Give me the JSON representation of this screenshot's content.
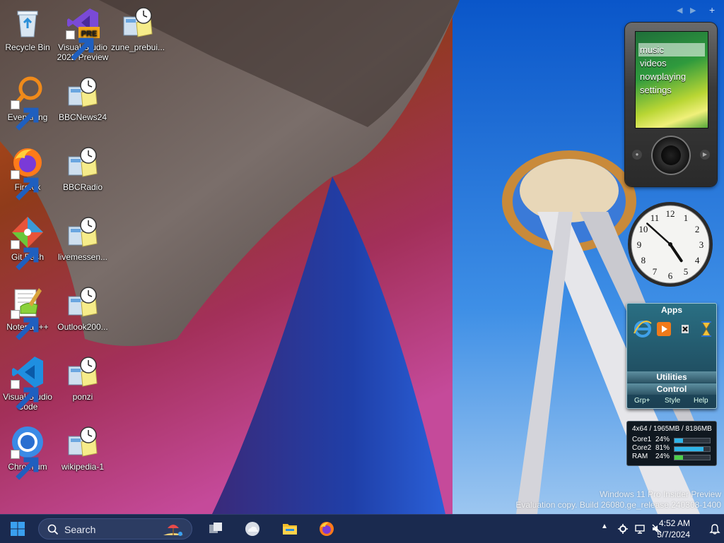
{
  "desktop": {
    "icons": [
      {
        "label": "Recycle Bin",
        "icon": "recycle-bin-icon"
      },
      {
        "label": "Visual Studio 2022 Preview",
        "icon": "visual-studio-preview-icon",
        "badge": "PRE"
      },
      {
        "label": "zune_prebui...",
        "icon": "gadget-file-icon"
      },
      {
        "label": "Everything",
        "icon": "everything-search-icon"
      },
      {
        "label": "BBCNews24",
        "icon": "gadget-file-icon"
      },
      {
        "label": "Firefox",
        "icon": "firefox-icon"
      },
      {
        "label": "BBCRadio",
        "icon": "gadget-file-icon"
      },
      {
        "label": "Git Bash",
        "icon": "git-bash-icon"
      },
      {
        "label": "livemessen...",
        "icon": "gadget-file-icon"
      },
      {
        "label": "Notepad++",
        "icon": "notepad-plus-plus-icon"
      },
      {
        "label": "Outlook200...",
        "icon": "gadget-file-icon"
      },
      {
        "label": "Visual Studio Code",
        "icon": "vscode-icon"
      },
      {
        "label": "ponzi",
        "icon": "gadget-file-icon"
      },
      {
        "label": "Chromium",
        "icon": "chromium-icon"
      },
      {
        "label": "wikipedia-1",
        "icon": "gadget-file-icon"
      }
    ]
  },
  "zune": {
    "menu": [
      "music",
      "videos",
      "nowplaying",
      "settings"
    ],
    "selected": "music"
  },
  "clock": {
    "numbers": [
      "12",
      "1",
      "2",
      "3",
      "4",
      "5",
      "6",
      "7",
      "8",
      "9",
      "10",
      "11"
    ],
    "time": "4:52"
  },
  "apps_gadget": {
    "title": "Apps",
    "icons": [
      "internet-explorer-icon",
      "media-player-icon",
      "calculator-icon",
      "hourglass-icon"
    ],
    "sections": [
      "Utilities",
      "Control"
    ],
    "footer": [
      "Grp+",
      "Style",
      "Help"
    ]
  },
  "cpu_gadget": {
    "caption": "4x64 / 1965MB / 8186MB",
    "rows": [
      {
        "label": "Core1",
        "pct": "24%",
        "value": 0.24
      },
      {
        "label": "Core2",
        "pct": "81%",
        "value": 0.81
      },
      {
        "label": "RAM",
        "pct": "24%",
        "value": 0.24
      }
    ]
  },
  "watermark": {
    "line1": "Windows 11 Pro Insider Preview",
    "line2": "Evaluation copy. Build 26080.ge_release.240308-1400"
  },
  "taskbar": {
    "search_label": "Search",
    "time": "4:52 AM",
    "date": "5/7/2024"
  },
  "colors": {
    "taskbar": "#1a2a4f",
    "accent": "#0078d4"
  }
}
